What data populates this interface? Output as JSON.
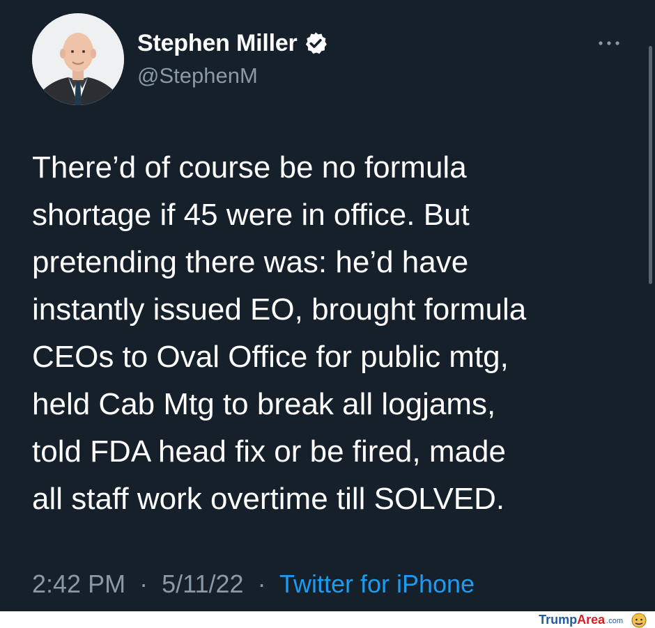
{
  "user": {
    "display_name": "Stephen Miller",
    "handle": "@StephenM",
    "verified": true
  },
  "tweet": {
    "lines": [
      "There’d of course be no formula",
      "shortage if 45 were in office. But",
      "pretending there was: he’d have",
      "instantly issued EO, brought formula",
      "CEOs to Oval Office for public mtg,",
      "held Cab Mtg to break all logjams,",
      "told FDA head fix or be fired, made",
      "all staff work overtime till SOLVED."
    ],
    "time": "2:42 PM",
    "date": "5/11/22",
    "separator": "·",
    "source": "Twitter for iPhone"
  },
  "watermark": {
    "part1": "Trump",
    "part2": "Area",
    "suffix": ".com"
  },
  "icons": {
    "verified": "verified-badge-icon",
    "more": "more-options-icon",
    "avatar": "profile-photo"
  },
  "colors": {
    "background": "#15202b",
    "text": "#ffffff",
    "muted": "#8b98a5",
    "link": "#1d9bf0"
  }
}
